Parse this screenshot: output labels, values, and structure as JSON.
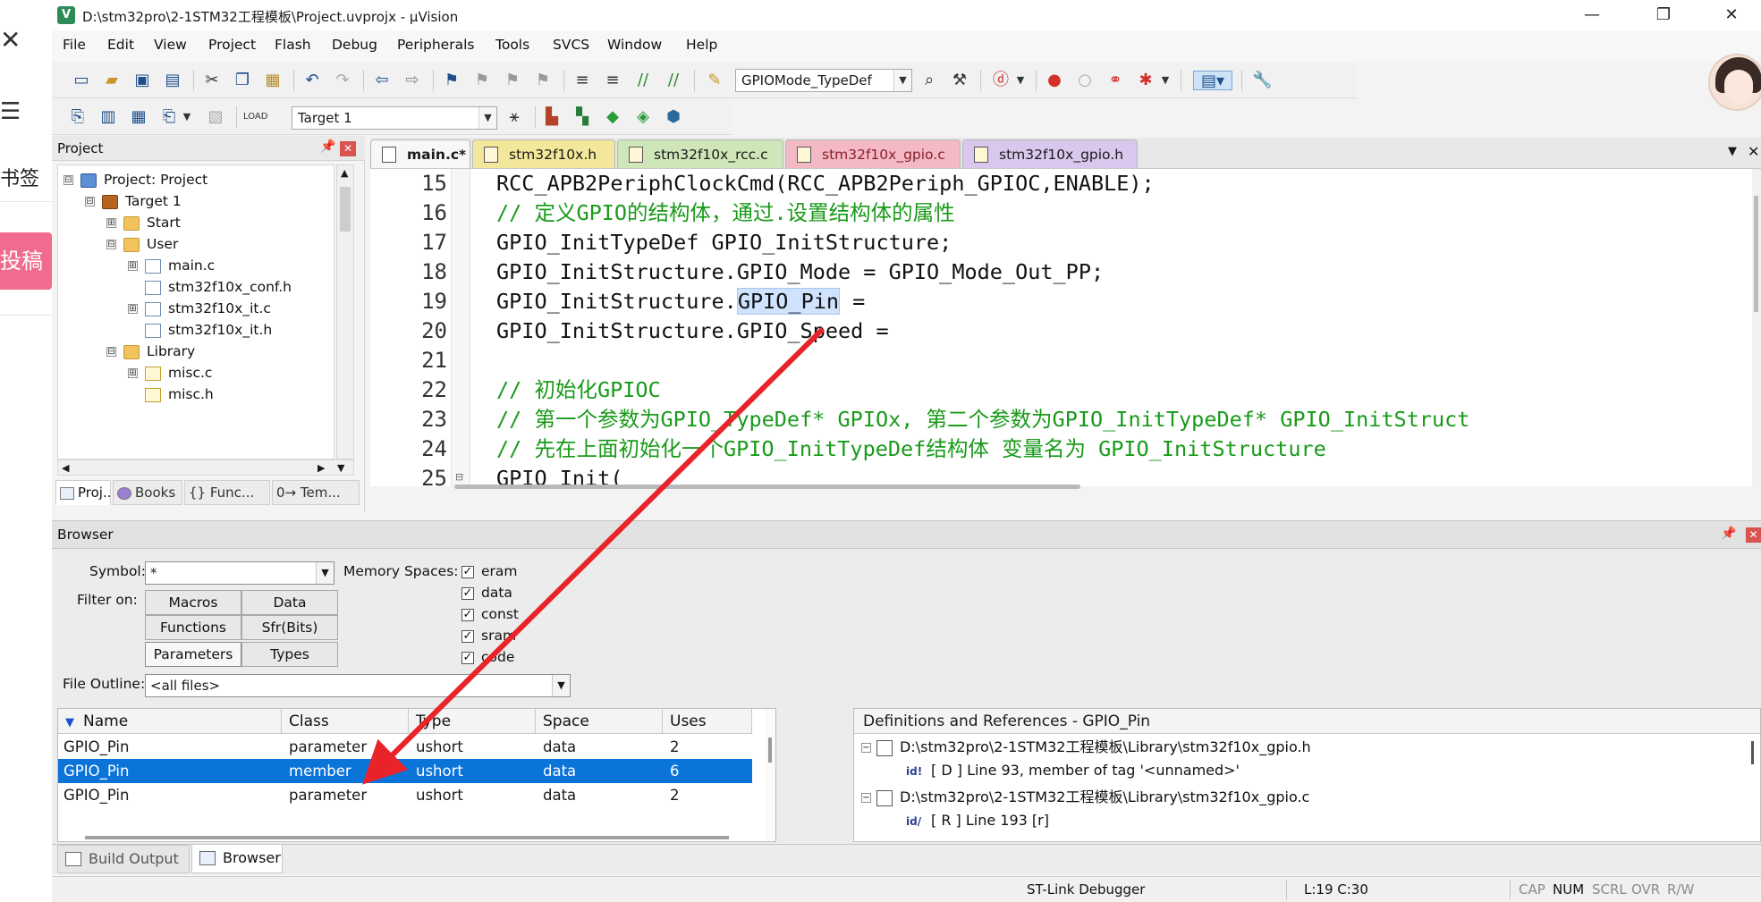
{
  "left_strip": {
    "close_glyph": "✕",
    "menu_glyph": "☰",
    "bookmark_label": "书签",
    "post_label": "投稿"
  },
  "window": {
    "title": "D:\\stm32pro\\2-1STM32工程模板\\Project.uvprojx - µVision",
    "app_icon": "V",
    "minimize": "—",
    "maximize": "❐",
    "close": "✕"
  },
  "menu": [
    "File",
    "Edit",
    "View",
    "Project",
    "Flash",
    "Debug",
    "Peripherals",
    "Tools",
    "SVCS",
    "Window",
    "Help"
  ],
  "toolbar": {
    "find_combo_value": "GPIOMode_TypeDef",
    "target_combo_value": "Target 1"
  },
  "project": {
    "title": "Project",
    "pin": "📌",
    "close": "✕",
    "tree": [
      {
        "label": "Project: Project",
        "expander": "⊟",
        "icon": "proj"
      },
      {
        "label": "Target 1",
        "expander": "⊟",
        "icon": "target"
      },
      {
        "label": "Start",
        "expander": "⊞",
        "icon": "folder"
      },
      {
        "label": "User",
        "expander": "⊟",
        "icon": "folder"
      },
      {
        "label": "main.c",
        "expander": "⊞",
        "icon": "file"
      },
      {
        "label": "stm32f10x_conf.h",
        "expander": "",
        "icon": "file"
      },
      {
        "label": "stm32f10x_it.c",
        "expander": "⊞",
        "icon": "file"
      },
      {
        "label": "stm32f10x_it.h",
        "expander": "",
        "icon": "file"
      },
      {
        "label": "Library",
        "expander": "⊟",
        "icon": "folder"
      },
      {
        "label": "misc.c",
        "expander": "⊞",
        "icon": "hfile"
      },
      {
        "label": "misc.h",
        "expander": "",
        "icon": "hfile"
      }
    ],
    "tabs": [
      "Proj...",
      "Books",
      "{} Func...",
      "0→ Tem..."
    ]
  },
  "editor": {
    "tabs": [
      {
        "label": "main.c*",
        "color": "#f7f7f7"
      },
      {
        "label": "stm32f10x.h",
        "color": "#f3e79b"
      },
      {
        "label": "stm32f10x_rcc.c",
        "color": "#cfe6b8"
      },
      {
        "label": "stm32f10x_gpio.c",
        "color": "#f3b9c5"
      },
      {
        "label": "stm32f10x_gpio.h",
        "color": "#d9c7ee"
      }
    ],
    "line_numbers": [
      "15",
      "16",
      "17",
      "18",
      "19",
      "20",
      "21",
      "22",
      "23",
      "24",
      "25"
    ],
    "lines": [
      {
        "text": "RCC_APB2PeriphClockCmd(RCC_APB2Periph_GPIOC,ENABLE);",
        "comment": false
      },
      {
        "text": "// 定义GPIO的结构体，通过.设置结构体的属性",
        "comment": true
      },
      {
        "text": "GPIO_InitTypeDef GPIO_InitStructure;",
        "comment": false
      },
      {
        "text": "GPIO_InitStructure.GPIO_Mode = GPIO_Mode_Out_PP;",
        "comment": false
      },
      {
        "text_before": "GPIO_InitStructure.",
        "highlight": "GPIO_Pin",
        "text_after": " =",
        "comment": false
      },
      {
        "text": "GPIO_InitStructure.GPIO_Speed =",
        "comment": false
      },
      {
        "text": "",
        "comment": false
      },
      {
        "text": "// 初始化GPIOC",
        "comment": true
      },
      {
        "text": "// 第一个参数为GPIO_TypeDef* GPIOx, 第二个参数为GPIO_InitTypeDef* GPIO_InitStruct",
        "comment": true
      },
      {
        "text": "// 先在上面初始化一个GPIO_InitTypeDef结构体 变量名为 GPIO_InitStructure",
        "comment": true
      },
      {
        "text": "GPIO_Init(",
        "comment": false
      }
    ]
  },
  "browser": {
    "title": "Browser",
    "symbol_label": "Symbol:",
    "symbol_value": "*",
    "filter_label": "Filter on:",
    "filters": [
      "Macros",
      "Data",
      "Functions",
      "Sfr(Bits)",
      "Parameters",
      "Types"
    ],
    "memory_label": "Memory Spaces:",
    "memory_spaces": [
      {
        "label": "eram",
        "checked": "✓"
      },
      {
        "label": "data",
        "checked": "✓"
      },
      {
        "label": "const",
        "checked": "✓"
      },
      {
        "label": "sram",
        "checked": "✓"
      },
      {
        "label": "code",
        "checked": "✓"
      }
    ],
    "file_outline_label": "File Outline:",
    "file_outline_value": "<all files>",
    "columns": [
      "Name",
      "Class",
      "Type",
      "Space",
      "Uses"
    ],
    "sort_glyph": "▼",
    "rows": [
      {
        "name": "GPIO_Pin",
        "class": "parameter",
        "type": "ushort",
        "space": "data",
        "uses": "2"
      },
      {
        "name": "GPIO_Pin",
        "class": "member",
        "type": "ushort",
        "space": "data",
        "uses": "6"
      },
      {
        "name": "GPIO_Pin",
        "class": "parameter",
        "type": "ushort",
        "space": "data",
        "uses": "2"
      }
    ],
    "defs_title": "Definitions and References - GPIO_Pin",
    "defs": [
      {
        "text": "D:\\stm32pro\\2-1STM32工程模板\\Library\\stm32f10x_gpio.h",
        "kind": "file"
      },
      {
        "text": "[ D ] Line 93, member of tag '<unnamed>'",
        "kind": "ref",
        "badge": "id!"
      },
      {
        "text": "D:\\stm32pro\\2-1STM32工程模板\\Library\\stm32f10x_gpio.c",
        "kind": "file"
      },
      {
        "text": "[ R ] Line 193 [r]",
        "kind": "ref",
        "badge": "id/"
      }
    ]
  },
  "bottom_tabs": [
    "Build Output",
    "Browser"
  ],
  "status": {
    "debugger": "ST-Link Debugger",
    "position": "L:19 C:30",
    "cap": "CAP",
    "num": "NUM",
    "scrl": "SCRL",
    "ovr": "OVR",
    "rw": "R/W"
  },
  "colors": {
    "arrow": "#e8242a",
    "selection": "#0a74d9",
    "comment": "#199a19"
  }
}
